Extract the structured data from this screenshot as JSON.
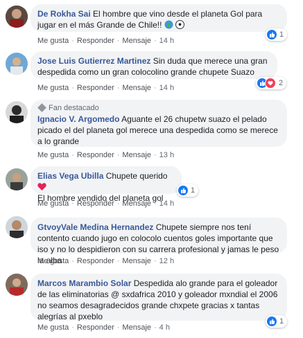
{
  "action_labels": {
    "like": "Me gusta",
    "reply": "Responder",
    "message": "Mensaje"
  },
  "comments": [
    {
      "author": "De Rokha Sai",
      "text": "El hombre que vino desde el planeta Gol para jugar en el más Grande de Chile!!",
      "emoji_names": [
        "globe-icon",
        "soccer-ball-icon"
      ],
      "time": "14 h",
      "reactions": {
        "types": [
          "like"
        ],
        "count": "1"
      }
    },
    {
      "author": "Jose Luis Gutierrez Martinez",
      "text": "Sin duda que merece una gran despedida como un gran colocolino grande chupete Suazo",
      "time": "14 h",
      "reactions": {
        "types": [
          "like",
          "love"
        ],
        "count": "2"
      }
    },
    {
      "badge": "Fan destacado",
      "author": "Ignacio V. Argomedo",
      "text": "Aguante el 26 chupetw suazo el pelado picado el del planeta gol merece una despedida como se merece a lo grande",
      "time": "13 h"
    },
    {
      "author": "Elias Vega Ubilla",
      "line1": "Chupete querido",
      "line1_emoji": "red-heart-icon",
      "line2": "El hombre vendido del planeta gol",
      "time": "14 h",
      "reactions": {
        "types": [
          "like"
        ],
        "count": "1"
      }
    },
    {
      "author": "GtvoyVale Medina Hernandez",
      "text": "Chupete siempre nos tení contento cuando jugo en colocolo cuentos goles importante que iso y no lo despidieron con su carrera profesional y jamas le peso la alba",
      "time": "12 h"
    },
    {
      "author": "Marcos Marambio Solar",
      "text": "Despedida alo grande para el goleador de las eliminatorias @ sxdafrica 2010 y goleador mxndial el 2006 no seamos desagradecidos grande chxpete gracias x tantas alegrías al pxeblo",
      "time": "4 h",
      "reactions": {
        "types": [
          "like"
        ],
        "count": "1"
      }
    }
  ],
  "colors": {
    "link": "#385898",
    "bubble": "#f2f3f5",
    "like": "#1877f2",
    "love": "#f33e58",
    "meta": "#606770"
  }
}
